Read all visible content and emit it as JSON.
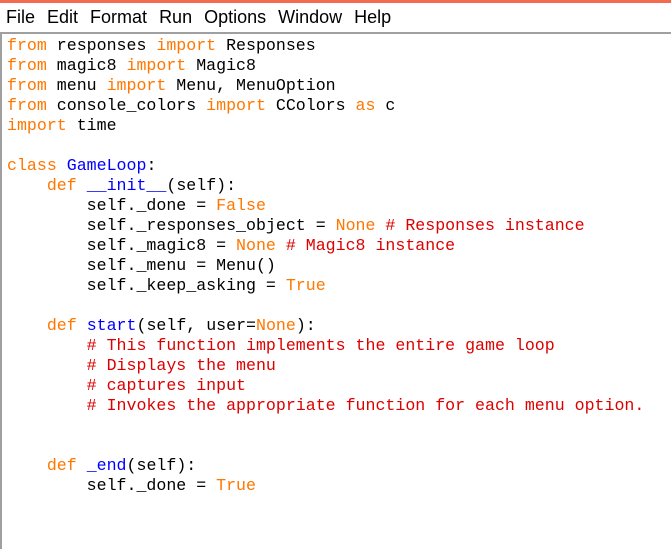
{
  "menubar": {
    "items": [
      "File",
      "Edit",
      "Format",
      "Run",
      "Options",
      "Window",
      "Help"
    ]
  },
  "colors": {
    "keyword": "#ff7700",
    "definition": "#0000ff",
    "comment": "#dd0000",
    "text": "#000000",
    "title_strip": "#f26b4e"
  },
  "code": {
    "lines": [
      [
        {
          "t": "from",
          "c": "kw"
        },
        {
          "t": " responses "
        },
        {
          "t": "import",
          "c": "kw"
        },
        {
          "t": " Responses"
        }
      ],
      [
        {
          "t": "from",
          "c": "kw"
        },
        {
          "t": " magic8 "
        },
        {
          "t": "import",
          "c": "kw"
        },
        {
          "t": " Magic8"
        }
      ],
      [
        {
          "t": "from",
          "c": "kw"
        },
        {
          "t": " menu "
        },
        {
          "t": "import",
          "c": "kw"
        },
        {
          "t": " Menu, MenuOption"
        }
      ],
      [
        {
          "t": "from",
          "c": "kw"
        },
        {
          "t": " console_colors "
        },
        {
          "t": "import",
          "c": "kw"
        },
        {
          "t": " CColors "
        },
        {
          "t": "as",
          "c": "kw"
        },
        {
          "t": " c"
        }
      ],
      [
        {
          "t": "import",
          "c": "kw"
        },
        {
          "t": " time"
        }
      ],
      [],
      [
        {
          "t": "class",
          "c": "kw"
        },
        {
          "t": " "
        },
        {
          "t": "GameLoop",
          "c": "def"
        },
        {
          "t": ":"
        }
      ],
      [
        {
          "t": "    "
        },
        {
          "t": "def",
          "c": "kw"
        },
        {
          "t": " "
        },
        {
          "t": "__init__",
          "c": "def"
        },
        {
          "t": "(self):"
        }
      ],
      [
        {
          "t": "        self._done = "
        },
        {
          "t": "False",
          "c": "kw"
        }
      ],
      [
        {
          "t": "        self._responses_object = "
        },
        {
          "t": "None",
          "c": "kw"
        },
        {
          "t": " # Responses instance",
          "c": "cm"
        }
      ],
      [
        {
          "t": "        self._magic8 = "
        },
        {
          "t": "None",
          "c": "kw"
        },
        {
          "t": " # Magic8 instance",
          "c": "cm"
        }
      ],
      [
        {
          "t": "        self._menu = Menu()"
        }
      ],
      [
        {
          "t": "        self._keep_asking = "
        },
        {
          "t": "True",
          "c": "kw"
        }
      ],
      [],
      [
        {
          "t": "    "
        },
        {
          "t": "def",
          "c": "kw"
        },
        {
          "t": " "
        },
        {
          "t": "start",
          "c": "def"
        },
        {
          "t": "(self, user="
        },
        {
          "t": "None",
          "c": "kw"
        },
        {
          "t": "):"
        }
      ],
      [
        {
          "t": "        "
        },
        {
          "t": "# This function implements the entire game loop",
          "c": "cm"
        }
      ],
      [
        {
          "t": "        "
        },
        {
          "t": "# Displays the menu",
          "c": "cm"
        }
      ],
      [
        {
          "t": "        "
        },
        {
          "t": "# captures input",
          "c": "cm"
        }
      ],
      [
        {
          "t": "        "
        },
        {
          "t": "# Invokes the appropriate function for each menu option.",
          "c": "cm"
        }
      ],
      [],
      [],
      [
        {
          "t": "    "
        },
        {
          "t": "def",
          "c": "kw"
        },
        {
          "t": " "
        },
        {
          "t": "_end",
          "c": "def"
        },
        {
          "t": "(self):"
        }
      ],
      [
        {
          "t": "        self._done = "
        },
        {
          "t": "True",
          "c": "kw"
        }
      ]
    ]
  }
}
